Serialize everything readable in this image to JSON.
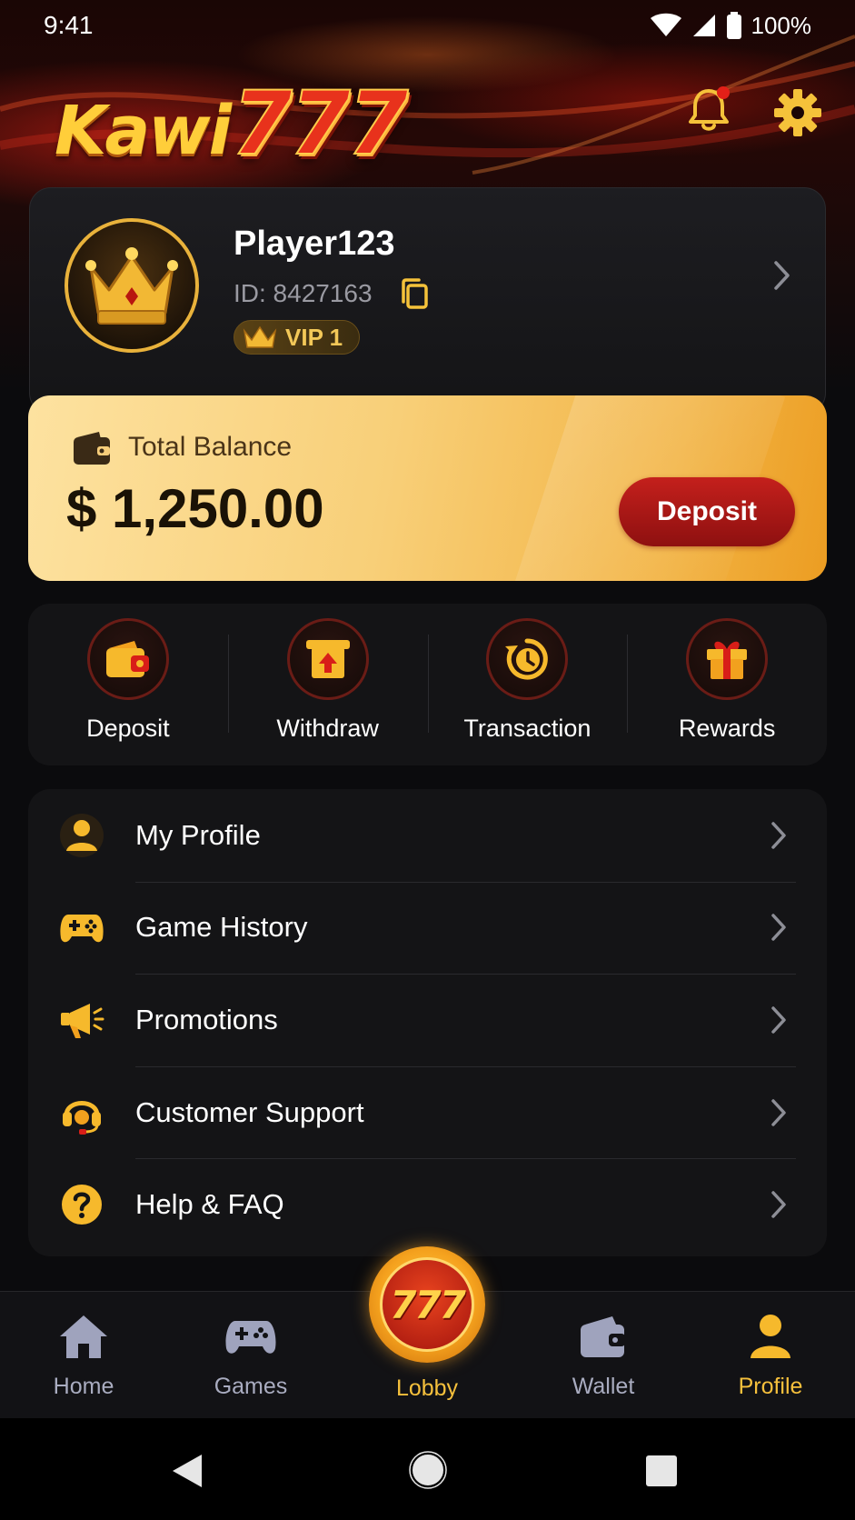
{
  "status_bar": {
    "time": "9:41",
    "battery": "100%"
  },
  "header": {
    "logo_text": "Kawi",
    "logo_number": "777"
  },
  "profile": {
    "name": "Player123",
    "id_text": "ID: 8427163",
    "vip": "VIP 1"
  },
  "balance": {
    "label": "Total Balance",
    "amount": "$ 1,250.00",
    "deposit_button": "Deposit"
  },
  "quick_actions": [
    {
      "label": "Deposit",
      "icon": "wallet-deposit-icon"
    },
    {
      "label": "Withdraw",
      "icon": "withdraw-icon"
    },
    {
      "label": "Transaction",
      "icon": "history-clock-icon"
    },
    {
      "label": "Rewards",
      "icon": "gift-icon"
    }
  ],
  "menu": [
    {
      "label": "My Profile",
      "icon": "user-icon"
    },
    {
      "label": "Game History",
      "icon": "gamepad-icon"
    },
    {
      "label": "Promotions",
      "icon": "megaphone-icon"
    },
    {
      "label": "Customer Support",
      "icon": "headset-icon"
    },
    {
      "label": "Help & FAQ",
      "icon": "question-icon"
    }
  ],
  "bottom_nav": {
    "home": "Home",
    "games": "Games",
    "lobby": "Lobby",
    "lobby_badge": "777",
    "wallet": "Wallet",
    "profile": "Profile",
    "active": "Profile"
  },
  "colors": {
    "accent_gold": "#f6c03c",
    "deposit_red": "#b01a16",
    "card_bg": "#141416",
    "page_bg": "#0b0b0d"
  }
}
